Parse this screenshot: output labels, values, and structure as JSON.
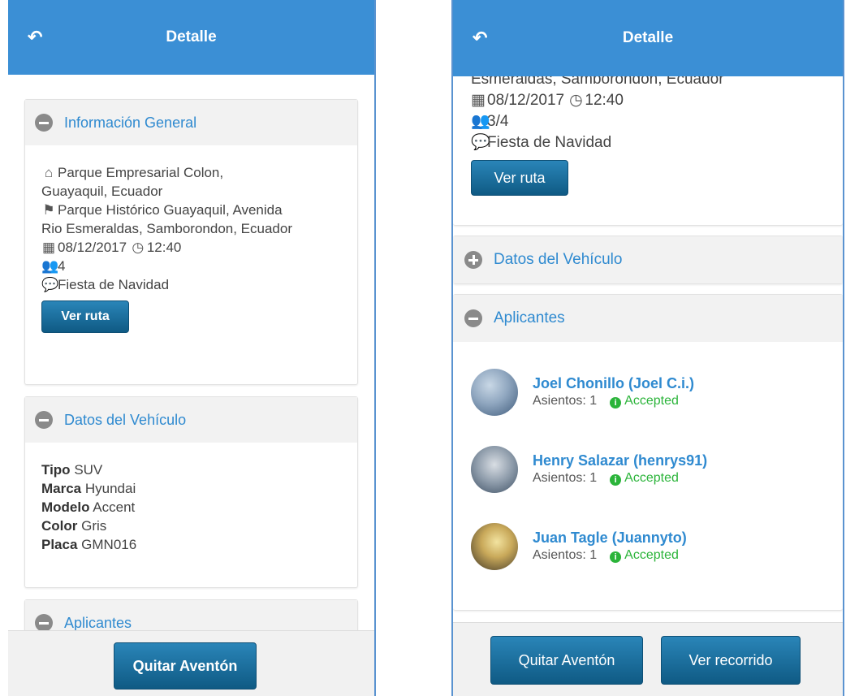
{
  "left": {
    "header": {
      "title": "Detalle",
      "back_icon": "↶"
    },
    "info_card": {
      "title": "Información General",
      "origin_icon": "home-icon",
      "origin_line1": "Parque Empresarial Colon,",
      "origin_line2": "Guayaquil, Ecuador",
      "dest_line1": "Parque Histórico Guayaquil, Avenida",
      "dest_line2": "Rio Esmeraldas, Samborondon, Ecuador",
      "date": "08/12/2017",
      "time": "12:40",
      "seats": "4",
      "description": "Fiesta de Navidad",
      "route_button": "Ver ruta"
    },
    "vehicle_card": {
      "title": "Datos del Vehículo",
      "rows": [
        {
          "label": "Tipo",
          "value": "SUV"
        },
        {
          "label": "Marca",
          "value": "Hyundai"
        },
        {
          "label": "Modelo",
          "value": "Accent"
        },
        {
          "label": "Color",
          "value": "Gris"
        },
        {
          "label": "Placa",
          "value": "GMN016"
        }
      ]
    },
    "applicants_card": {
      "title": "Aplicantes"
    },
    "footer": {
      "remove_button": "Quitar Aventón"
    }
  },
  "right": {
    "header": {
      "title": "Detalle",
      "back_icon": "↶"
    },
    "info_card": {
      "dest_partial": "Esmeraldas, Samborondon, Ecuador",
      "date": "08/12/2017",
      "time": "12:40",
      "seats": "3/4",
      "description": "Fiesta de Navidad",
      "route_button": "Ver ruta"
    },
    "vehicle_card": {
      "title": "Datos del Vehículo"
    },
    "applicants_card": {
      "title": "Aplicantes",
      "applicants": [
        {
          "name": "Joel Chonillo (Joel C.i.)",
          "seats_label": "Asientos: 1",
          "status": "Accepted"
        },
        {
          "name": "Henry Salazar (henrys91)",
          "seats_label": "Asientos: 1",
          "status": "Accepted"
        },
        {
          "name": "Juan Tagle (Juannyto)",
          "seats_label": "Asientos: 1",
          "status": "Accepted"
        }
      ]
    },
    "footer": {
      "remove_button": "Quitar Aventón",
      "tour_button": "Ver recorrido"
    }
  },
  "colors": {
    "header": "#3b8fd5",
    "link": "#2f8ad0",
    "button": "#14638f",
    "accepted": "#2bb43a"
  }
}
